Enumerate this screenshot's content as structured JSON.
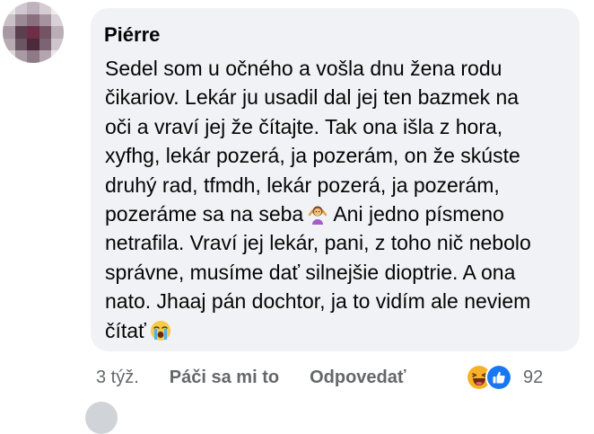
{
  "comment": {
    "author": "Piérre",
    "lines": [
      "Sedel som u očného a vošla dnu žena rodu",
      "čikariov. Lekár ju usadil dal jej ten bazmek na",
      "oči a vraví jej že čítajte. Tak ona išla z hora,",
      "xyfhg, lekár pozerá, ja pozerám, on že skúste",
      "druhý rad, tfmdh, lekár pozerá, ja pozerám,",
      "pozeráme sa na seba",
      "Ani jedno písmeno",
      "netrafila. Vraví jej lekár, pani, z toho nič nebolo",
      "správne, musíme dať silnejšie dioptrie. A ona",
      "nato. Jhaaj pán dochtor, ja to vidím ale neviem",
      "čítať"
    ],
    "inline_emoji": [
      "person-shrugging-icon",
      "crying-face-icon"
    ]
  },
  "actions": {
    "time": "3 týž.",
    "like_label": "Páči sa mi to",
    "reply_label": "Odpovedať"
  },
  "reactions": {
    "count": "92",
    "icons": [
      "haha-reaction-icon",
      "like-reaction-icon"
    ]
  },
  "colors": {
    "bubble": "#f0f2f5",
    "text": "#050505",
    "secondary": "#65676b",
    "like_blue": "#1877f2",
    "haha_yellow": "#f7b125"
  }
}
